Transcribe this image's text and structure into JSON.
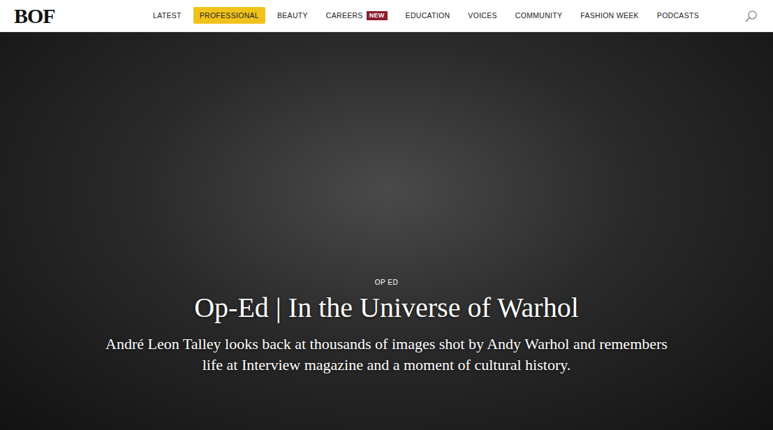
{
  "logo": "BOF",
  "nav": [
    {
      "label": "LATEST",
      "selected": false
    },
    {
      "label": "PROFESSIONAL",
      "selected": true
    },
    {
      "label": "BEAUTY",
      "selected": false
    },
    {
      "label": "CAREERS",
      "selected": false,
      "badge": "NEW"
    },
    {
      "label": "EDUCATION",
      "selected": false
    },
    {
      "label": "VOICES",
      "selected": false
    },
    {
      "label": "COMMUNITY",
      "selected": false
    },
    {
      "label": "FASHION WEEK",
      "selected": false
    },
    {
      "label": "PODCASTS",
      "selected": false
    }
  ],
  "hero": {
    "kicker": "OP ED",
    "title": "Op-Ed | In the Universe of Warhol",
    "subtitle": "André Leon Talley looks back at thousands of images shot by Andy Warhol and remembers life at Interview magazine and a moment of cultural history."
  }
}
